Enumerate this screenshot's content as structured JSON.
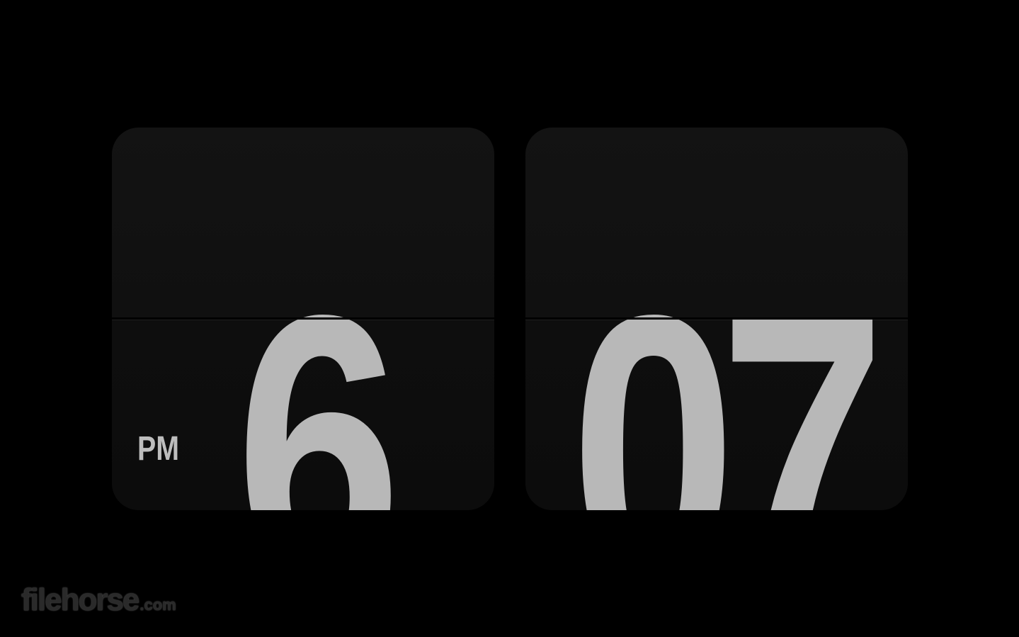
{
  "clock": {
    "hours": "6",
    "minutes": "07",
    "period": "PM"
  },
  "watermark": {
    "brand": "filehorse",
    "suffix": ".com"
  },
  "colors": {
    "background": "#000000",
    "card": "#101010",
    "digit": "#b8b8b8"
  }
}
